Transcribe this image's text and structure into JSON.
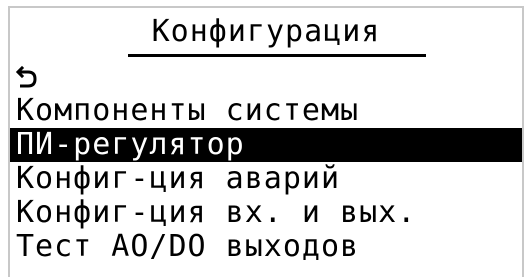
{
  "screen": {
    "title": "Конфигурация"
  },
  "menu": {
    "items": [
      {
        "label": "",
        "icon": "back-arrow-icon"
      },
      {
        "label": "Компоненты системы"
      },
      {
        "label": "ПИ-регулятор",
        "selected": true
      },
      {
        "label": "Конфиг-ция аварий"
      },
      {
        "label": "Конфиг-ция вх. и вых."
      },
      {
        "label": "Тест AO/DO выходов"
      }
    ]
  },
  "colors": {
    "foreground": "#000000",
    "background": "#ffffff",
    "selection_background": "#000000",
    "selection_foreground": "#ffffff"
  }
}
